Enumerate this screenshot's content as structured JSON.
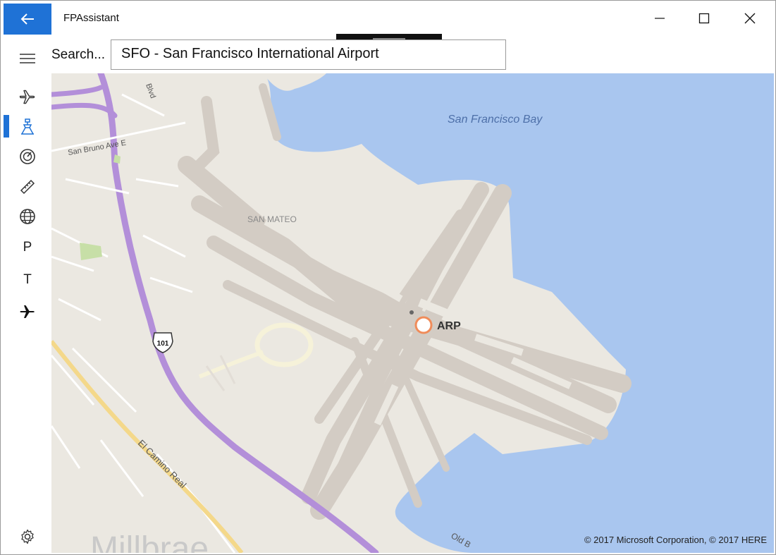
{
  "app": {
    "title": "FPAssistant"
  },
  "titlebar": {
    "back_icon": "back-arrow-icon",
    "minimize_icon": "minimize-icon",
    "maximize_icon": "maximize-icon",
    "close_icon": "close-icon"
  },
  "sidebar": {
    "items": [
      {
        "name": "hamburger-menu",
        "icon": "hamburger-icon"
      },
      {
        "name": "flights",
        "icon": "airplane-outline-icon"
      },
      {
        "name": "airport",
        "icon": "airport-tower-icon",
        "active": true
      },
      {
        "name": "performance",
        "icon": "gauge-icon"
      },
      {
        "name": "measure",
        "icon": "ruler-icon"
      },
      {
        "name": "world",
        "icon": "globe-icon"
      },
      {
        "name": "p",
        "label": "P"
      },
      {
        "name": "t",
        "label": "T"
      },
      {
        "name": "aircraft",
        "icon": "airplane-filled-icon"
      },
      {
        "name": "settings",
        "icon": "gear-icon"
      }
    ]
  },
  "search": {
    "label": "Search...",
    "value": "SFO - San Francisco International Airport"
  },
  "map": {
    "labels": {
      "bay": "San Francisco Bay",
      "san_mateo": "SAN MATEO",
      "san_bruno": "San Bruno Ave E",
      "blvd": "Blvd",
      "el_camino": "El Camino Real",
      "old_b": "Old B",
      "millbrae": "Millbrae",
      "hwy": "101",
      "marker": "ARP"
    },
    "copyright": "© 2017 Microsoft Corporation, © 2017 HERE",
    "colors": {
      "water": "#a9c6ef",
      "land": "#ebe8e1",
      "runway": "#d3ccc4",
      "highway": "#b38fd9",
      "road": "#f4d88a",
      "marker": "#f08c5a",
      "accent": "#1f72d6"
    }
  }
}
